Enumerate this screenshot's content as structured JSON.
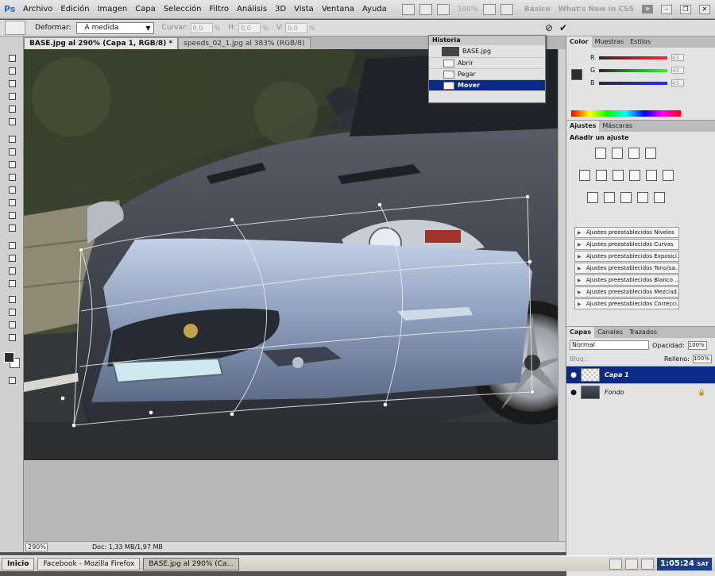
{
  "app": {
    "logo": "Ps"
  },
  "menu": [
    "Archivo",
    "Edición",
    "Imagen",
    "Capa",
    "Selección",
    "Filtro",
    "Análisis",
    "3D",
    "Vista",
    "Ventana",
    "Ayuda"
  ],
  "menu_zoom": "100%",
  "workspace": {
    "basico": "Básico",
    "whats_new": "What's New in CS5",
    "more": "»"
  },
  "options": {
    "warp_label": "Deformar:",
    "warp_value": "A medida",
    "curvar_label": "Curvar:",
    "curvar_value": "0,0",
    "h_label": "H:",
    "h_value": "0,0",
    "v_label": "V:",
    "v_value": "0,0",
    "pct": "%"
  },
  "tabs": [
    {
      "label": "BASE.jpg al 290% (Capa 1, RGB/8) *"
    },
    {
      "label": "speeds_02_1.jpg al 383% (RGB/8)"
    }
  ],
  "status": {
    "zoom": "290%",
    "doc": "Doc: 1,33 MB/1,97 MB"
  },
  "history": {
    "title": "Historia",
    "snapshot": "BASE.jpg",
    "steps": [
      "Abrir",
      "Pegar",
      "Mover"
    ],
    "selected": 2
  },
  "color_panel": {
    "tabs": [
      "Color",
      "Muestras",
      "Estilos"
    ],
    "channels": [
      {
        "label": "R",
        "value": "43"
      },
      {
        "label": "G",
        "value": "43"
      },
      {
        "label": "B",
        "value": "43"
      }
    ]
  },
  "adjust_panel": {
    "tabs": [
      "Ajustes",
      "Máscaras"
    ],
    "title": "Añadir un ajuste",
    "presets": [
      "Ajustes preestablecidos Niveles",
      "Ajustes preestablecidos Curvas",
      "Ajustes preestablecidos Exposici...",
      "Ajustes preestablecidos Tono/sa...",
      "Ajustes preestablecidos Blanco ...",
      "Ajustes preestablecidos Mezclad...",
      "Ajustes preestablecidos Correcci..."
    ]
  },
  "layers_panel": {
    "tabs": [
      "Capas",
      "Canales",
      "Trazados"
    ],
    "blend_mode": "Normal",
    "opacity_label": "Opacidad:",
    "opacity": "100%",
    "lock_label": "Bloq.:",
    "fill_label": "Relleno:",
    "fill": "100%",
    "layers": [
      {
        "name": "Capa 1"
      },
      {
        "name": "Fondo"
      }
    ]
  },
  "taskbar": {
    "start": "Inicio",
    "tasks": [
      "Facebook - Mozilla Firefox",
      "BASE.jpg al 290% (Ca..."
    ],
    "time": "1:05:24",
    "day": "SAT"
  },
  "colors": {
    "selection": "#0a2a88",
    "car_body": "#3a3e47",
    "bumper": "#8fa0bc"
  }
}
